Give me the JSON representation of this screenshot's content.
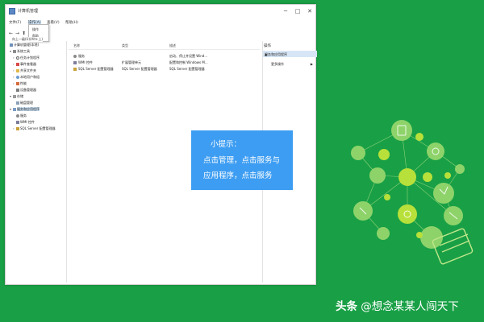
{
  "window": {
    "title": "计算机管理",
    "controls": {
      "minimize": "─",
      "maximize": "□",
      "close": "✕"
    }
  },
  "menu": {
    "items": [
      "文件(F)",
      "操作(A)",
      "查看(V)",
      "帮助(H)"
    ],
    "dropdown_items": [
      "操作",
      "帮助"
    ]
  },
  "tooltip_fragment": "向上一级(U)(Alt+上)",
  "tree": {
    "items": [
      {
        "label": "计算机管理(本地)",
        "level": 0,
        "toggle": "",
        "selected": false
      },
      {
        "label": "系统工具",
        "level": 1,
        "toggle": "▾",
        "selected": false
      },
      {
        "label": "任务计划程序",
        "level": 2,
        "toggle": "›",
        "selected": false
      },
      {
        "label": "事件查看器",
        "level": 2,
        "toggle": "›",
        "selected": false
      },
      {
        "label": "共享文件夹",
        "level": 2,
        "toggle": "›",
        "selected": false
      },
      {
        "label": "本地用户和组",
        "level": 2,
        "toggle": "›",
        "selected": false
      },
      {
        "label": "性能",
        "level": 2,
        "toggle": "›",
        "selected": false
      },
      {
        "label": "设备管理器",
        "level": 2,
        "toggle": "",
        "selected": false
      },
      {
        "label": "存储",
        "level": 1,
        "toggle": "▾",
        "selected": false
      },
      {
        "label": "磁盘管理",
        "level": 2,
        "toggle": "",
        "selected": false
      },
      {
        "label": "服务和应用程序",
        "level": 1,
        "toggle": "▾",
        "selected": true
      },
      {
        "label": "服务",
        "level": 2,
        "toggle": "",
        "selected": false
      },
      {
        "label": "WMI 控件",
        "level": 2,
        "toggle": "",
        "selected": false
      },
      {
        "label": "SQL Server 配置管理器",
        "level": 2,
        "toggle": "›",
        "selected": false
      }
    ]
  },
  "list": {
    "columns": [
      "名称",
      "类型",
      "描述"
    ],
    "rows": [
      {
        "name": "服务",
        "type": "",
        "desc": "启动、停止并设置 Wind..."
      },
      {
        "name": "WMI 控件",
        "type": "扩展管理单元",
        "desc": "配置和控制 Windows M..."
      },
      {
        "name": "SQL Server 配置管理器",
        "type": "SQL Server 配置管理器",
        "desc": "SQL Server 配置管理器"
      }
    ]
  },
  "actions": {
    "title": "操作",
    "section": "服务和应用程序",
    "more": "更多操作"
  },
  "hint": {
    "title": "小提示：",
    "line1": "点击管理，点击服务与",
    "line2": "应用程序，点击服务"
  },
  "watermark": {
    "brand": "头条",
    "author": "@想念某某人闯天下"
  },
  "colors": {
    "background": "#19a046",
    "hint_box": "#3d9df2",
    "selection": "#cde3f7",
    "deco_lime": "#b8e03a",
    "deco_light": "#8ed36a"
  }
}
